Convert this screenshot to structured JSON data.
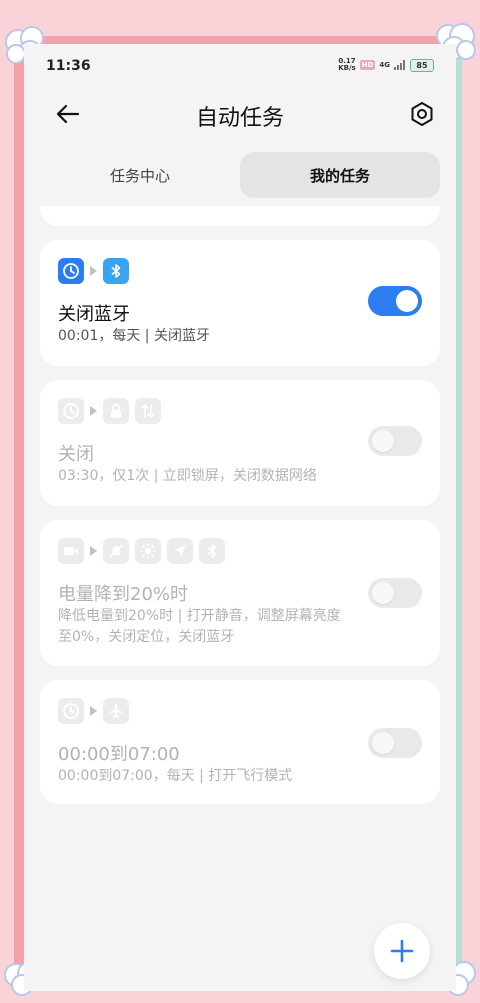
{
  "status_bar": {
    "time": "11:36",
    "speed_value": "0.17",
    "speed_unit": "KB/s",
    "hd_badge": "HD",
    "network": "4G",
    "battery": "85"
  },
  "header": {
    "title": "自动任务",
    "back_icon": "back-arrow-icon",
    "settings_icon": "gear-icon"
  },
  "tabs": [
    {
      "label": "任务中心",
      "active": false
    },
    {
      "label": "我的任务",
      "active": true
    }
  ],
  "tasks": [
    {
      "title": "关闭蓝牙",
      "desc": "00:01，每天 | 关闭蓝牙",
      "enabled": true,
      "icons": [
        "clock-icon",
        "bluetooth-icon"
      ]
    },
    {
      "title": "关闭",
      "desc": "03:30，仅1次 | 立即锁屏，关闭数据网络",
      "enabled": false,
      "icons": [
        "clock-icon",
        "lock-icon",
        "mobile-data-icon"
      ]
    },
    {
      "title": "电量降到20%时",
      "desc": "降低电量到20%时 | 打开静音，调整屏幕亮度至0%，关闭定位，关闭蓝牙",
      "enabled": false,
      "icons": [
        "battery-trigger-icon",
        "mute-icon",
        "brightness-icon",
        "location-icon",
        "bluetooth-icon"
      ]
    },
    {
      "title": "00:00到07:00",
      "desc": "00:00到07:00，每天 | 打开飞行模式",
      "enabled": false,
      "icons": [
        "clock-icon",
        "airplane-icon"
      ]
    }
  ],
  "fab_icon": "plus-icon",
  "colors": {
    "accent": "#2b7df0",
    "frame_pink": "#f3a2a9",
    "frame_mint": "#b9ded1"
  }
}
